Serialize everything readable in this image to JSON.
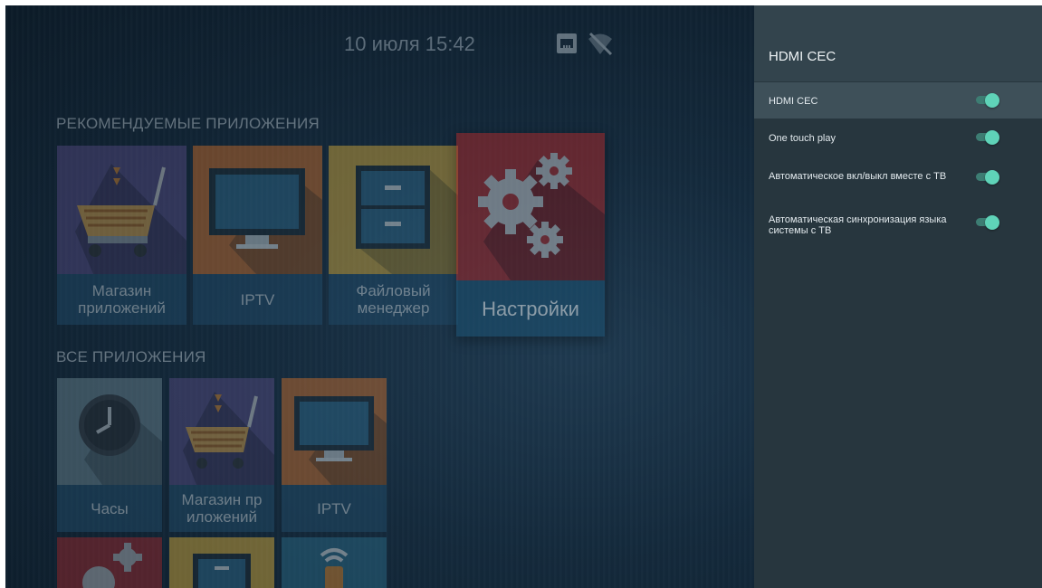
{
  "status_bar": {
    "datetime": "10 июля 15:42",
    "ethernet_icon": "ethernet-icon",
    "wifi_icon": "wifi-off-icon"
  },
  "home": {
    "recommended_title": "РЕКОМЕНДУЕМЫЕ ПРИЛОЖЕНИЯ",
    "recommended": [
      {
        "label": "Магазин приложений",
        "icon": "shopping-cart-icon",
        "color": "#5a4d86"
      },
      {
        "label": "IPTV",
        "icon": "monitor-icon",
        "color": "#d6732a"
      },
      {
        "label": "Файловый менеджер",
        "icon": "file-cabinet-icon",
        "color": "#e2b43a"
      },
      {
        "label": "Настройки",
        "icon": "gears-icon",
        "color": "#a5282b"
      }
    ],
    "all_title": "ВСЕ ПРИЛОЖЕНИЯ",
    "all": [
      {
        "label": "Часы",
        "icon": "clock-icon",
        "color": "#6f8a94"
      },
      {
        "label": "Магазин пр иложений",
        "icon": "shopping-cart-icon",
        "color": "#5a4d86"
      },
      {
        "label": "IPTV",
        "icon": "monitor-icon",
        "color": "#d6732a"
      },
      {
        "label": "",
        "icon": "gears-icon",
        "color": "#a5282b"
      },
      {
        "label": "",
        "icon": "file-cabinet-icon",
        "color": "#e2b43a"
      },
      {
        "label": "",
        "icon": "remote-icon",
        "color": "#2c6f8c"
      }
    ]
  },
  "panel": {
    "title": "HDMI CEC",
    "items": [
      {
        "label": "HDMI CEC",
        "enabled": true,
        "selected": true
      },
      {
        "label": "One touch play",
        "enabled": true,
        "selected": false
      },
      {
        "label": "Автоматическое вкл/выкл вместе с ТВ",
        "enabled": true,
        "selected": false
      },
      {
        "label": "Автоматическая синхронизация языка системы с ТВ",
        "enabled": true,
        "selected": false
      }
    ]
  },
  "colors": {
    "accent": "#5fd3b8",
    "panel_bg": "#27363e",
    "panel_header": "#33444d",
    "row_selected": "#3e5059"
  }
}
